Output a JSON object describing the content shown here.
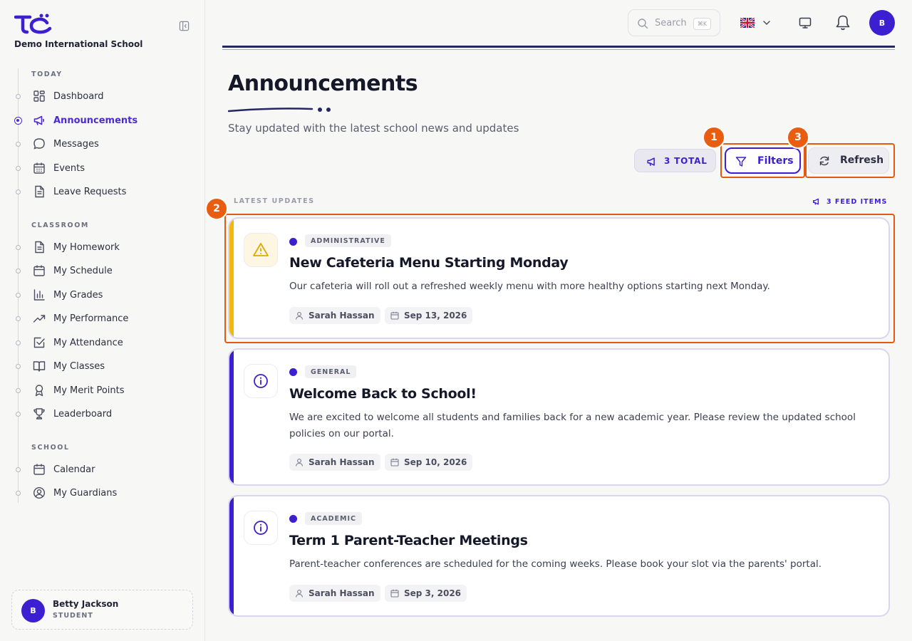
{
  "sidebar": {
    "school_name": "Demo International School",
    "sections": [
      {
        "label": "TODAY"
      },
      {
        "label": "CLASSROOM"
      },
      {
        "label": "SCHOOL"
      }
    ],
    "items": [
      {
        "label": "Dashboard",
        "icon": "dashboard-icon"
      },
      {
        "label": "Announcements",
        "icon": "megaphone-icon",
        "active": true
      },
      {
        "label": "Messages",
        "icon": "message-icon"
      },
      {
        "label": "Events",
        "icon": "calendar-grid-icon"
      },
      {
        "label": "Leave Requests",
        "icon": "document-icon"
      },
      {
        "label": "My Homework",
        "icon": "document-icon"
      },
      {
        "label": "My Schedule",
        "icon": "calendar-icon"
      },
      {
        "label": "My Grades",
        "icon": "bar-chart-icon"
      },
      {
        "label": "My Performance",
        "icon": "trending-up-icon"
      },
      {
        "label": "My Attendance",
        "icon": "checkbox-icon"
      },
      {
        "label": "My Classes",
        "icon": "book-icon"
      },
      {
        "label": "My Merit Points",
        "icon": "award-icon"
      },
      {
        "label": "Leaderboard",
        "icon": "trophy-icon"
      },
      {
        "label": "Calendar",
        "icon": "calendar-icon"
      },
      {
        "label": "My Guardians",
        "icon": "user-circle-icon"
      }
    ],
    "user": {
      "initial": "B",
      "name": "Betty Jackson",
      "role": "STUDENT"
    }
  },
  "topbar": {
    "search_placeholder": "Search",
    "search_shortcut": "⌘K",
    "language": "en-GB",
    "avatar_initial": "B"
  },
  "page": {
    "title": "Announcements",
    "subtitle": "Stay updated with the latest school news and updates"
  },
  "toolbar": {
    "total_label": "3 TOTAL",
    "filters_label": "Filters",
    "refresh_label": "Refresh"
  },
  "highlights": [
    "1",
    "2",
    "3"
  ],
  "feed": {
    "label": "LATEST UPDATES",
    "count_label": "3 FEED ITEMS"
  },
  "announcements": [
    {
      "category": "ADMINISTRATIVE",
      "title": "New Cafeteria Menu Starting Monday",
      "body": "Our cafeteria will roll out a refreshed weekly menu with more healthy options starting next Monday.",
      "author": "Sarah Hassan",
      "date": "Sep 13, 2026",
      "icon": "warning-icon",
      "accent_color": "#f2b90c"
    },
    {
      "category": "GENERAL",
      "title": "Welcome Back to School!",
      "body": "We are excited to welcome all students and families back for a new academic year. Please review the updated school policies on our portal.",
      "author": "Sarah Hassan",
      "date": "Sep 10, 2026",
      "icon": "info-icon",
      "accent_color": "#3b1fd1"
    },
    {
      "category": "ACADEMIC",
      "title": "Term 1 Parent-Teacher Meetings",
      "body": "Parent-teacher conferences are scheduled for the coming weeks. Please book your slot via the parents' portal.",
      "author": "Sarah Hassan",
      "date": "Sep 3, 2026",
      "icon": "info-icon",
      "accent_color": "#3b1fd1"
    }
  ],
  "colors": {
    "primary": "#3b1fd1",
    "highlight": "#e05a13",
    "warning": "#f2b90c"
  }
}
